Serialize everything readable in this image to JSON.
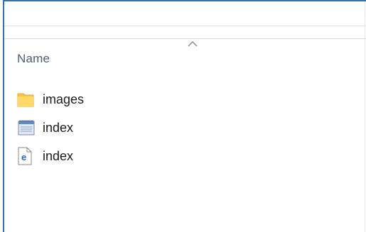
{
  "header": {
    "name_column": "Name",
    "sort_icon": "chevron-up-icon"
  },
  "files": [
    {
      "label": "images",
      "icon": "folder-icon"
    },
    {
      "label": "index",
      "icon": "text-document-icon"
    },
    {
      "label": "index",
      "icon": "edge-html-icon"
    }
  ],
  "colors": {
    "frame": "#3c6fa5",
    "header_text": "#4d5d78",
    "folder": "#f7c64a"
  }
}
